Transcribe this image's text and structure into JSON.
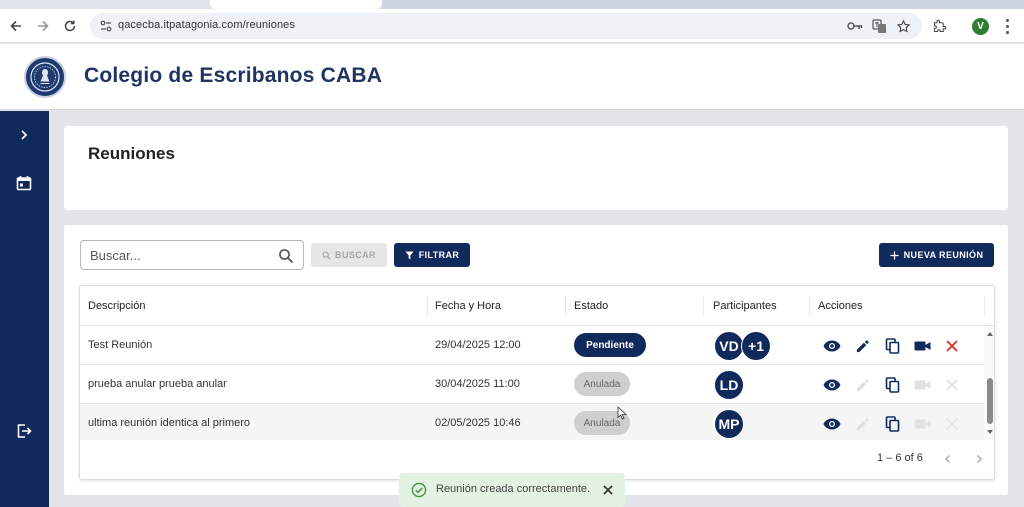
{
  "browser": {
    "url": "qacecba.itpatagonia.com/reuniones",
    "profile_initial": "V",
    "icons": [
      "back-icon",
      "forward-icon",
      "reload-icon",
      "site-info-icon",
      "key-icon",
      "translate-icon",
      "star-icon",
      "extensions-icon",
      "more-icon"
    ]
  },
  "header": {
    "title": "Colegio de Escribanos CABA"
  },
  "sidebar": {
    "items": [
      {
        "icon": "chevron-right-icon"
      },
      {
        "icon": "calendar-icon"
      },
      {
        "icon": "logout-icon"
      }
    ]
  },
  "page": {
    "title": "Reuniones"
  },
  "toolbar": {
    "search_placeholder": "Buscar...",
    "buscar_label": "BUSCAR",
    "filtrar_label": "FILTRAR",
    "nueva_label": "NUEVA REUNIÓN"
  },
  "table": {
    "columns": [
      "Descripción",
      "Fecha y Hora",
      "Estado",
      "Participantes",
      "Acciones"
    ],
    "rows": [
      {
        "descripcion": "Test Reunión",
        "fecha": "29/04/2025 12:00",
        "estado": "Pendiente",
        "participantes": [
          "VD",
          "+1"
        ]
      },
      {
        "descripcion": "prueba anular prueba anular",
        "fecha": "30/04/2025 11:00",
        "estado": "Anulada",
        "participantes": [
          "LD"
        ]
      },
      {
        "descripcion": "ultima reunión identica al primero",
        "fecha": "02/05/2025 10:46",
        "estado": "Anulada",
        "participantes": [
          "MP"
        ]
      }
    ],
    "actions": [
      "view-icon",
      "edit-icon",
      "copy-icon",
      "videocam-icon",
      "cancel-icon"
    ]
  },
  "paginator": {
    "range": "1 – 6 of 6"
  },
  "toast": {
    "message": "Reunión creada correctamente."
  },
  "colors": {
    "primary": "#102a5c",
    "title": "#1f3462",
    "danger": "#d32f2f",
    "disabled": "#cfcfcf",
    "toast_bg": "#e4f2e3"
  }
}
